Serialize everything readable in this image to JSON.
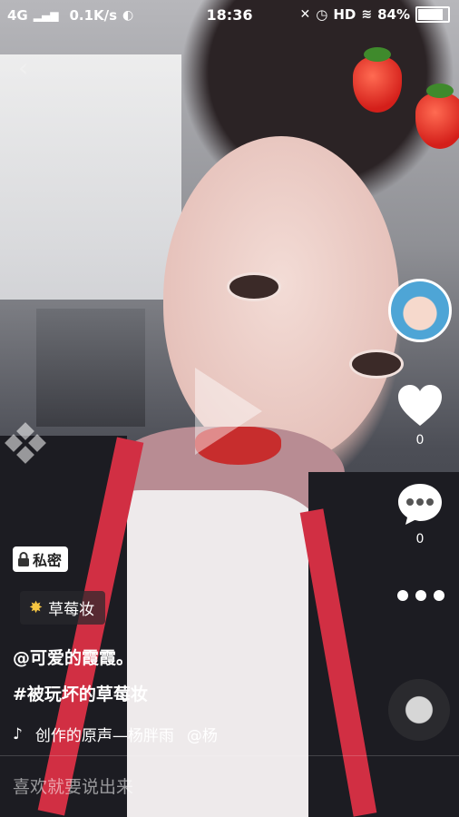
{
  "status_bar": {
    "network": "4G",
    "speed": "0.1K/s",
    "time": "18:36",
    "hd": "HD",
    "battery": "84%",
    "battery_level": 0.84
  },
  "video": {
    "private_badge": "私密",
    "filter_label": "草莓妆",
    "username": "@可爱的霞霞。",
    "hashtag": "#被玩坏的草莓妆",
    "music": "创作的原声—杨胖雨",
    "music_author": "@杨"
  },
  "actions": {
    "like_count": "0",
    "comment_count": "0"
  },
  "comment_bar": {
    "placeholder": "喜欢就要说出来"
  },
  "icons": [
    "back-icon",
    "play-icon",
    "diamond-icon",
    "heart-icon",
    "comment-icon",
    "more-icon",
    "lock-icon",
    "magic-wand-icon",
    "tiktok-note-icon",
    "wechat-icon",
    "alarm-icon",
    "wifi-icon"
  ]
}
